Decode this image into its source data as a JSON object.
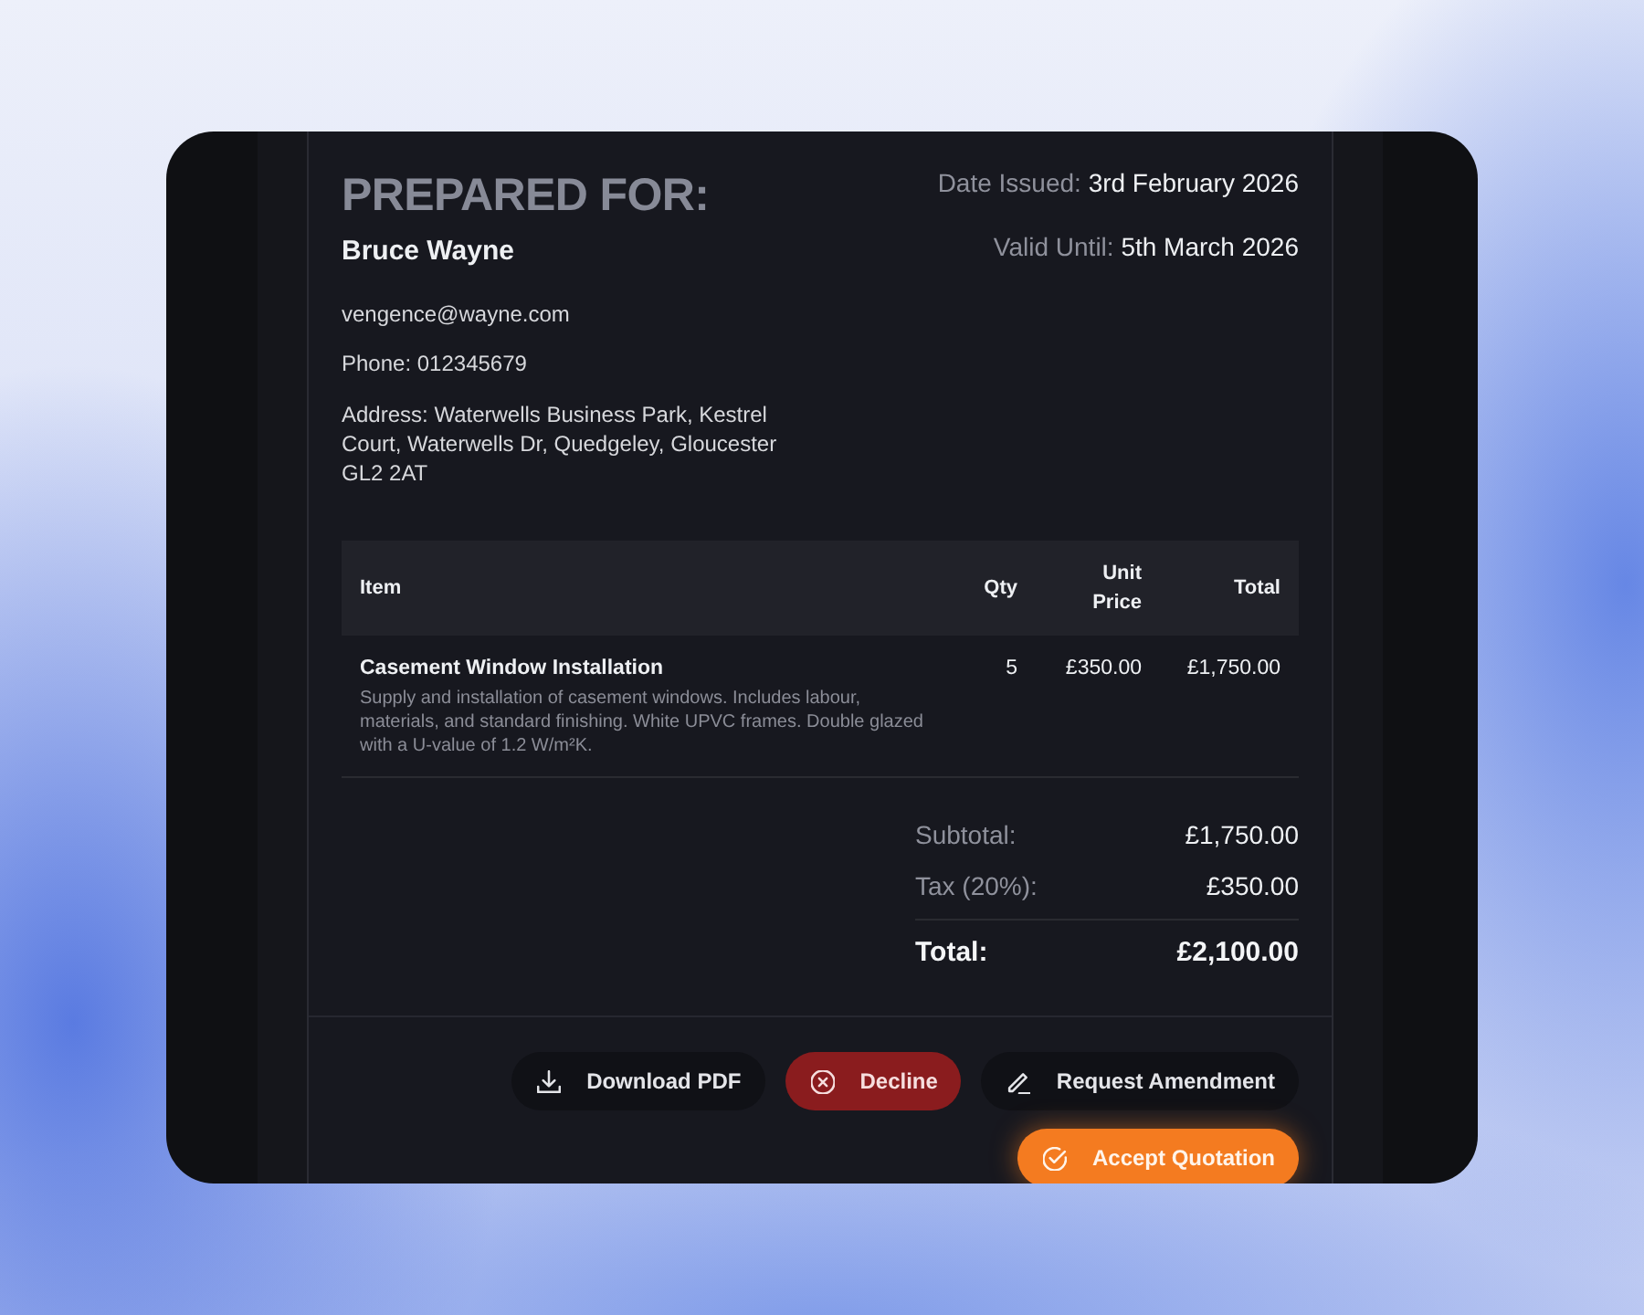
{
  "recipient": {
    "heading": "PREPARED FOR:",
    "name": "Bruce Wayne",
    "email": "vengence@wayne.com",
    "phone": "Phone: 012345679",
    "address": "Address: Waterwells Business Park, Kestrel Court, Waterwells Dr, Quedgeley, Gloucester GL2 2AT"
  },
  "dates": [
    {
      "label": "Date Issued:",
      "value": "3rd February 2026"
    },
    {
      "label": "Valid Until:",
      "value": "5th March 2026"
    }
  ],
  "table": {
    "columns": [
      "Item",
      "Qty",
      "Unit Price",
      "Total"
    ],
    "rows": [
      {
        "title": "Casement Window Installation",
        "description": "Supply and installation of casement windows. Includes labour, materials, and standard finishing. White UPVC frames. Double glazed with a U-value of 1.2 W/m²K.",
        "qty": "5",
        "unit_price": "£350.00",
        "total": "£1,750.00"
      }
    ]
  },
  "totals": [
    {
      "kind": "subtotal",
      "label": "Subtotal:",
      "value": "£1,750.00"
    },
    {
      "kind": "tax",
      "label": "Tax (20%):",
      "value": "£350.00"
    },
    {
      "kind": "total",
      "label": "Total:",
      "value": "£2,100.00"
    }
  ],
  "actions": [
    {
      "kind": "download",
      "label": "Download PDF"
    },
    {
      "kind": "decline",
      "label": "Decline"
    },
    {
      "kind": "amend",
      "label": "Request Amendment"
    },
    {
      "kind": "accept",
      "label": "Accept Quotation"
    }
  ]
}
